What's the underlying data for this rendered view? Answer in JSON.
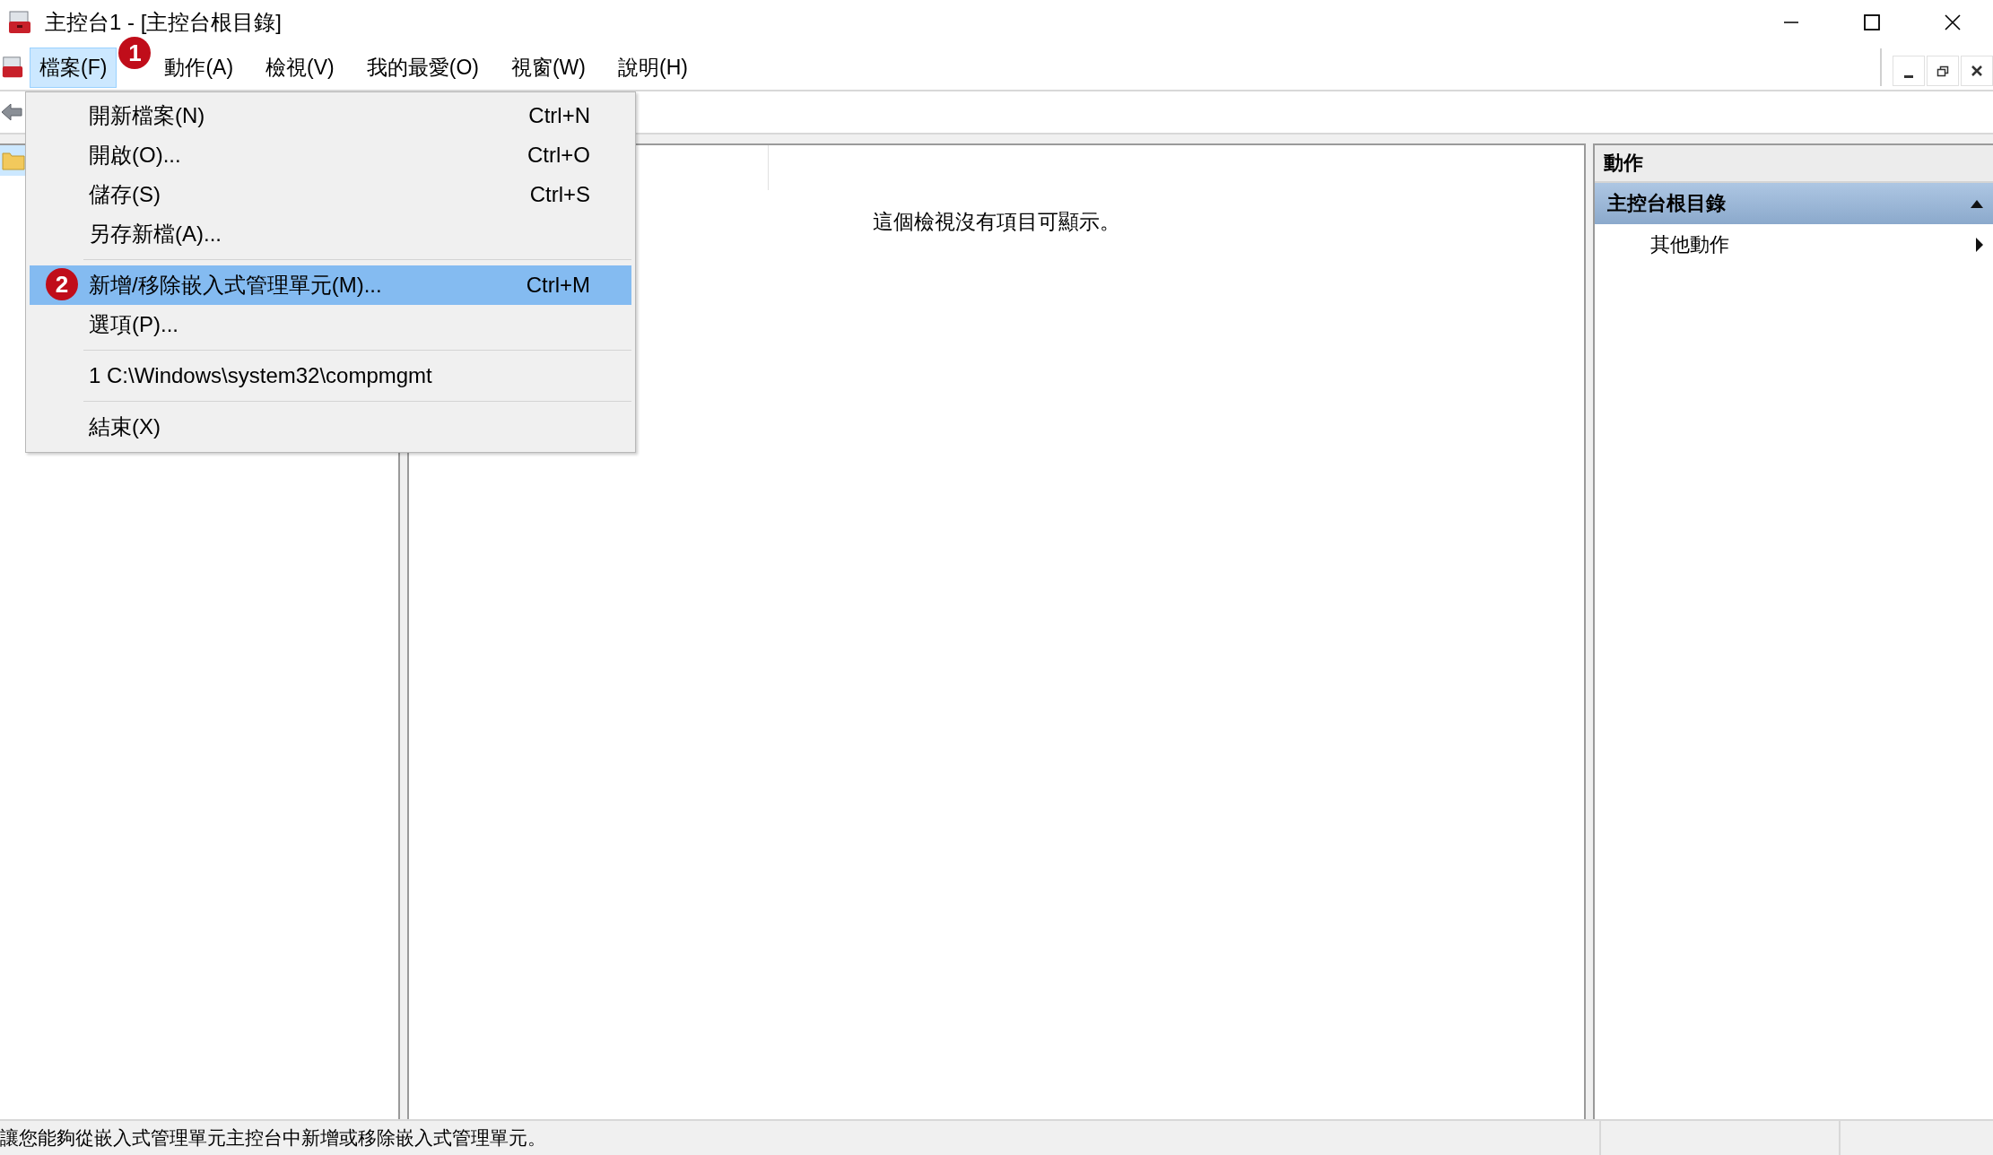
{
  "window": {
    "title": "主控台1 - [主控台根目錄]"
  },
  "menu_bar": {
    "items": [
      {
        "label": "檔案(F)",
        "selected": true,
        "callout": "1"
      },
      {
        "label": "動作(A)",
        "selected": false
      },
      {
        "label": "檢視(V)",
        "selected": false
      },
      {
        "label": "我的最愛(O)",
        "selected": false
      },
      {
        "label": "視窗(W)",
        "selected": false
      },
      {
        "label": "說明(H)",
        "selected": false
      }
    ]
  },
  "file_menu": {
    "groups": [
      [
        {
          "label": "開新檔案(N)",
          "shortcut": "Ctrl+N",
          "selected": false
        },
        {
          "label": "開啟(O)...",
          "shortcut": "Ctrl+O",
          "selected": false
        },
        {
          "label": "儲存(S)",
          "shortcut": "Ctrl+S",
          "selected": false
        },
        {
          "label": "另存新檔(A)...",
          "selected": false
        }
      ],
      [
        {
          "label": "新增/移除嵌入式管理單元(M)...",
          "shortcut": "Ctrl+M",
          "selected": true,
          "callout": "2"
        },
        {
          "label": "選項(P)...",
          "selected": false
        }
      ],
      [
        {
          "label": "1 C:\\Windows\\system32\\compmgmt",
          "selected": false
        }
      ],
      [
        {
          "label": "結束(X)",
          "selected": false
        }
      ]
    ]
  },
  "content": {
    "empty_message": "這個檢視沒有項目可顯示。"
  },
  "actions_pane": {
    "title": "動作",
    "sections": [
      {
        "title": "主控台根目錄",
        "expanded": true,
        "items": [
          {
            "label": "其他動作",
            "submenu": true
          }
        ]
      }
    ]
  },
  "status_bar": {
    "text": "讓您能夠從嵌入式管理單元主控台中新增或移除嵌入式管理單元。"
  }
}
